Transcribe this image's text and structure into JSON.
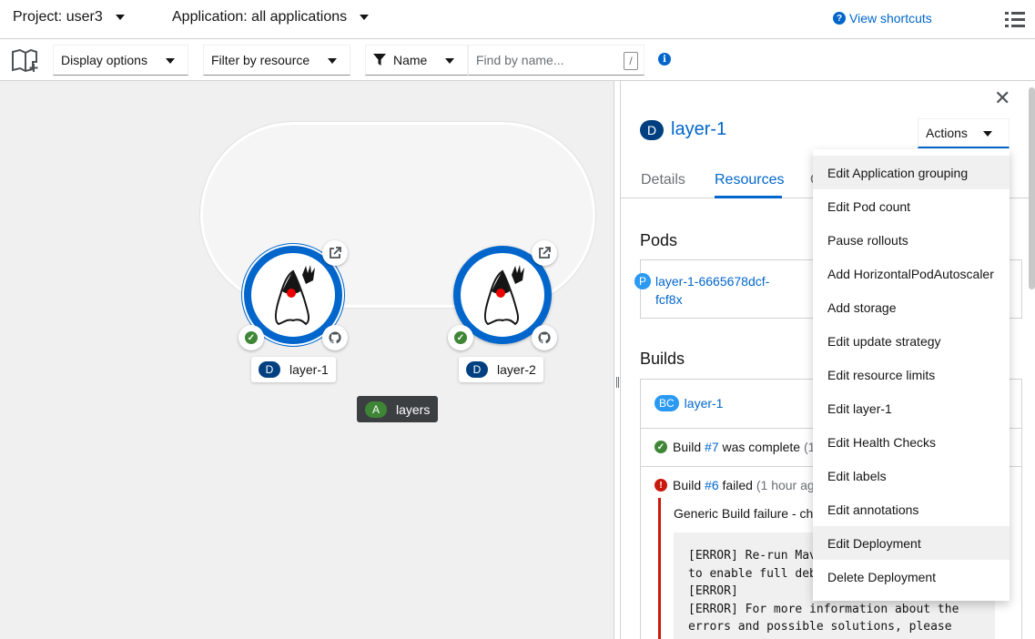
{
  "header": {
    "project": "Project: user3",
    "application": "Application: all applications",
    "shortcuts": "View shortcuts"
  },
  "toolbar": {
    "display_options": "Display options",
    "filter_by_resource": "Filter by resource",
    "filter_type": "Name",
    "search_placeholder": "Find by name...",
    "search_key": "/"
  },
  "topology": {
    "nodes": [
      {
        "badge": "D",
        "label": "layer-1"
      },
      {
        "badge": "D",
        "label": "layer-2"
      }
    ],
    "group": {
      "badge": "A",
      "label": "layers"
    }
  },
  "panel": {
    "badge": "D",
    "title": "layer-1",
    "actions_label": "Actions",
    "tabs": [
      "Details",
      "Resources",
      "O"
    ],
    "pods_heading": "Pods",
    "pod": {
      "badge": "P",
      "name": "layer-1-6665678dcf-fcf8x"
    },
    "builds_heading": "Builds",
    "build_config": {
      "badge": "BC",
      "name": "layer-1"
    },
    "build7": {
      "prefix": "Build ",
      "link": "#7",
      "status": " was complete ",
      "time": "(1"
    },
    "build6": {
      "prefix": "Build ",
      "link": "#6",
      "status": " failed ",
      "time": "(1 hour ag"
    },
    "failure_msg": "Generic Build failure - ch",
    "log": "[ERROR] Re-run Mav\nto enable full deb\n[ERROR]\n[ERROR] For more information about the\nerrors and possible solutions, please"
  },
  "menu": {
    "items": [
      "Edit Application grouping",
      "Edit Pod count",
      "Pause rollouts",
      "Add HorizontalPodAutoscaler",
      "Add storage",
      "Edit update strategy",
      "Edit resource limits",
      "Edit layer-1",
      "Edit Health Checks",
      "Edit labels",
      "Edit annotations",
      "Edit Deployment",
      "Delete Deployment"
    ]
  },
  "colors": {
    "accent": "#0066cc",
    "success": "#3e8635",
    "danger": "#c9190b",
    "deployment_badge": "#004080"
  }
}
